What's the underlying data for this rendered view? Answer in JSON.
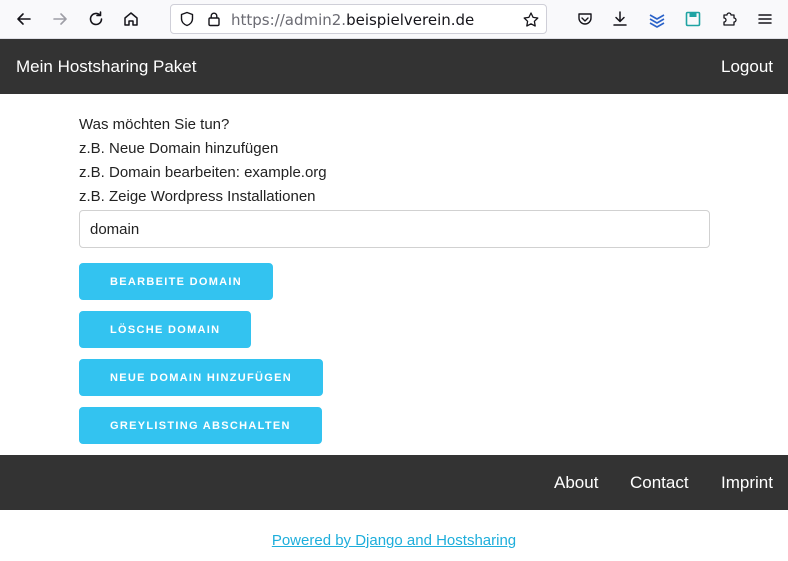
{
  "browser": {
    "url_prefix": "https://admin2.",
    "url_domain": "beispielverein.de"
  },
  "header": {
    "title": "Mein Hostsharing Paket",
    "logout_label": "Logout"
  },
  "main": {
    "prompt": "Was möchten Sie tun?",
    "examples": [
      "z.B. Neue Domain hinzufügen",
      "z.B. Domain bearbeiten: example.org",
      "z.B. Zeige Wordpress Installationen"
    ],
    "input_value": "domain",
    "buttons": [
      "Bearbeite Domain",
      "Lösche Domain",
      "Neue Domain hinzufügen",
      "Greylisting abschalten"
    ]
  },
  "footer": {
    "links": [
      "About",
      "Contact",
      "Imprint"
    ],
    "powered_by": "Powered by Django and Hostsharing"
  },
  "colors": {
    "accent": "#33c3f0",
    "header_bg": "#333333",
    "link": "#1eaedb"
  }
}
